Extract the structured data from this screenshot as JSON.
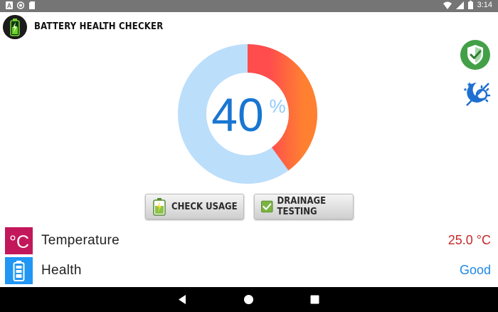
{
  "status_bar": {
    "time": "3:14",
    "icons": [
      "notification-a-icon",
      "record-icon",
      "sd-card-icon",
      "wifi-icon",
      "cellular-signal-icon",
      "battery-icon"
    ]
  },
  "app": {
    "title": "BATTERY HEALTH CHECKER"
  },
  "gauge": {
    "level_percent": 40,
    "value_label": "40",
    "unit": "%",
    "colors": {
      "track": "#bbdefb",
      "fill": "#ff4d4d",
      "fill_end": "#ff8030",
      "text": "#1976d2"
    }
  },
  "buttons": {
    "check_usage": "CHECK USAGE",
    "drainage_testing": "DRAINAGE TESTING"
  },
  "info_rows": [
    {
      "name": "Temperature",
      "value": "25.0 °C",
      "value_color": "#c62828",
      "icon": "celsius-icon",
      "icon_text": "°C",
      "icon_bg": "#c2185b"
    },
    {
      "name": "Health",
      "value": "Good",
      "value_color": "#1e88e5",
      "icon": "battery-icon",
      "icon_bg": "#2196f3"
    }
  ],
  "side_icons": [
    "shield-check-icon",
    "night-mode-icon"
  ],
  "nav": {
    "icons": [
      "back-icon",
      "home-icon",
      "recents-icon"
    ]
  }
}
